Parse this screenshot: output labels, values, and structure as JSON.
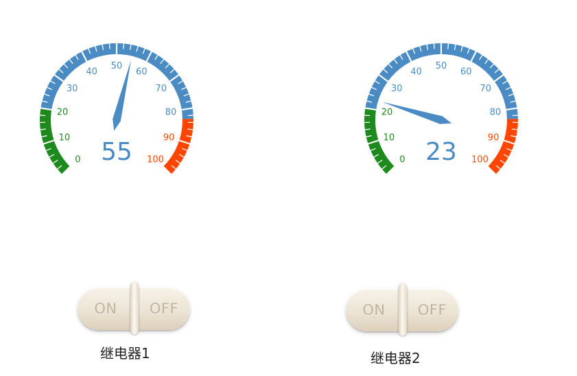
{
  "gauges": [
    {
      "value": 55,
      "display": "55",
      "min": 0,
      "max": 100,
      "tick_labels": [
        "0",
        "10",
        "20",
        "30",
        "40",
        "50",
        "60",
        "70",
        "80",
        "90",
        "100"
      ],
      "bands": [
        {
          "from": 0,
          "to": 20,
          "color": "#1e8a1e"
        },
        {
          "from": 20,
          "to": 83,
          "color": "#4a8bc4"
        },
        {
          "from": 83,
          "to": 100,
          "color": "#ff4500"
        }
      ]
    },
    {
      "value": 23,
      "display": "23",
      "min": 0,
      "max": 100,
      "tick_labels": [
        "0",
        "10",
        "20",
        "30",
        "40",
        "50",
        "60",
        "70",
        "80",
        "90",
        "100"
      ],
      "bands": [
        {
          "from": 0,
          "to": 20,
          "color": "#1e8a1e"
        },
        {
          "from": 20,
          "to": 83,
          "color": "#4a8bc4"
        },
        {
          "from": 83,
          "to": 100,
          "color": "#ff4500"
        }
      ]
    }
  ],
  "colors": {
    "needle": "#4a8bc4",
    "value_text": "#4a8bc4",
    "green": "#1e8a1e",
    "blue": "#4a8bc4",
    "red": "#ff4500"
  },
  "relays": [
    {
      "on_label": "ON",
      "off_label": "OFF",
      "name": "继电器1"
    },
    {
      "on_label": "ON",
      "off_label": "OFF",
      "name": "继电器2"
    }
  ]
}
